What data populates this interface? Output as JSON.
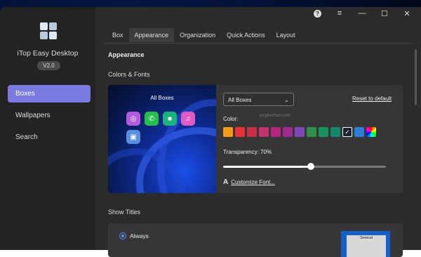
{
  "app": {
    "name": "iTop Easy Desktop",
    "version": "V2.0"
  },
  "sidebar": {
    "items": [
      {
        "label": "Boxes",
        "active": true
      },
      {
        "label": "Wallpapers",
        "active": false
      },
      {
        "label": "Search",
        "active": false
      }
    ]
  },
  "titlebar": {
    "help": "?",
    "menu": "≡",
    "minimize": "—",
    "maximize": "☐",
    "close": "✕"
  },
  "tabs": [
    {
      "label": "Box",
      "active": false
    },
    {
      "label": "Appearance",
      "active": true
    },
    {
      "label": "Organization",
      "active": false
    },
    {
      "label": "Quick Actions",
      "active": false
    },
    {
      "label": "Layout",
      "active": false
    }
  ],
  "appearance": {
    "section_title": "Appearance",
    "colors_fonts_title": "Colors & Fonts",
    "preview_title": "All Boxes",
    "box_select": "All Boxes",
    "reset_label": "Reset to default",
    "color_label": "Color:",
    "colors": [
      "#f39a1c",
      "#e8313b",
      "#c8304a",
      "#c4336b",
      "#b4267f",
      "#9e2b8f",
      "#7e49b6",
      "#2f8f4a",
      "#1a8f5f",
      "#13876e",
      "#1b2230",
      "#2b7fd8",
      "rainbow"
    ],
    "selected_color_index": 10,
    "transparency_label": "Transparency: 70%",
    "transparency_percent": 70,
    "custom_font_label": "Customize Font...",
    "watermark": "yinghezhan.com"
  },
  "show_titles": {
    "title": "Show Titles",
    "selected_option": "Always",
    "thumb_label": "General"
  }
}
